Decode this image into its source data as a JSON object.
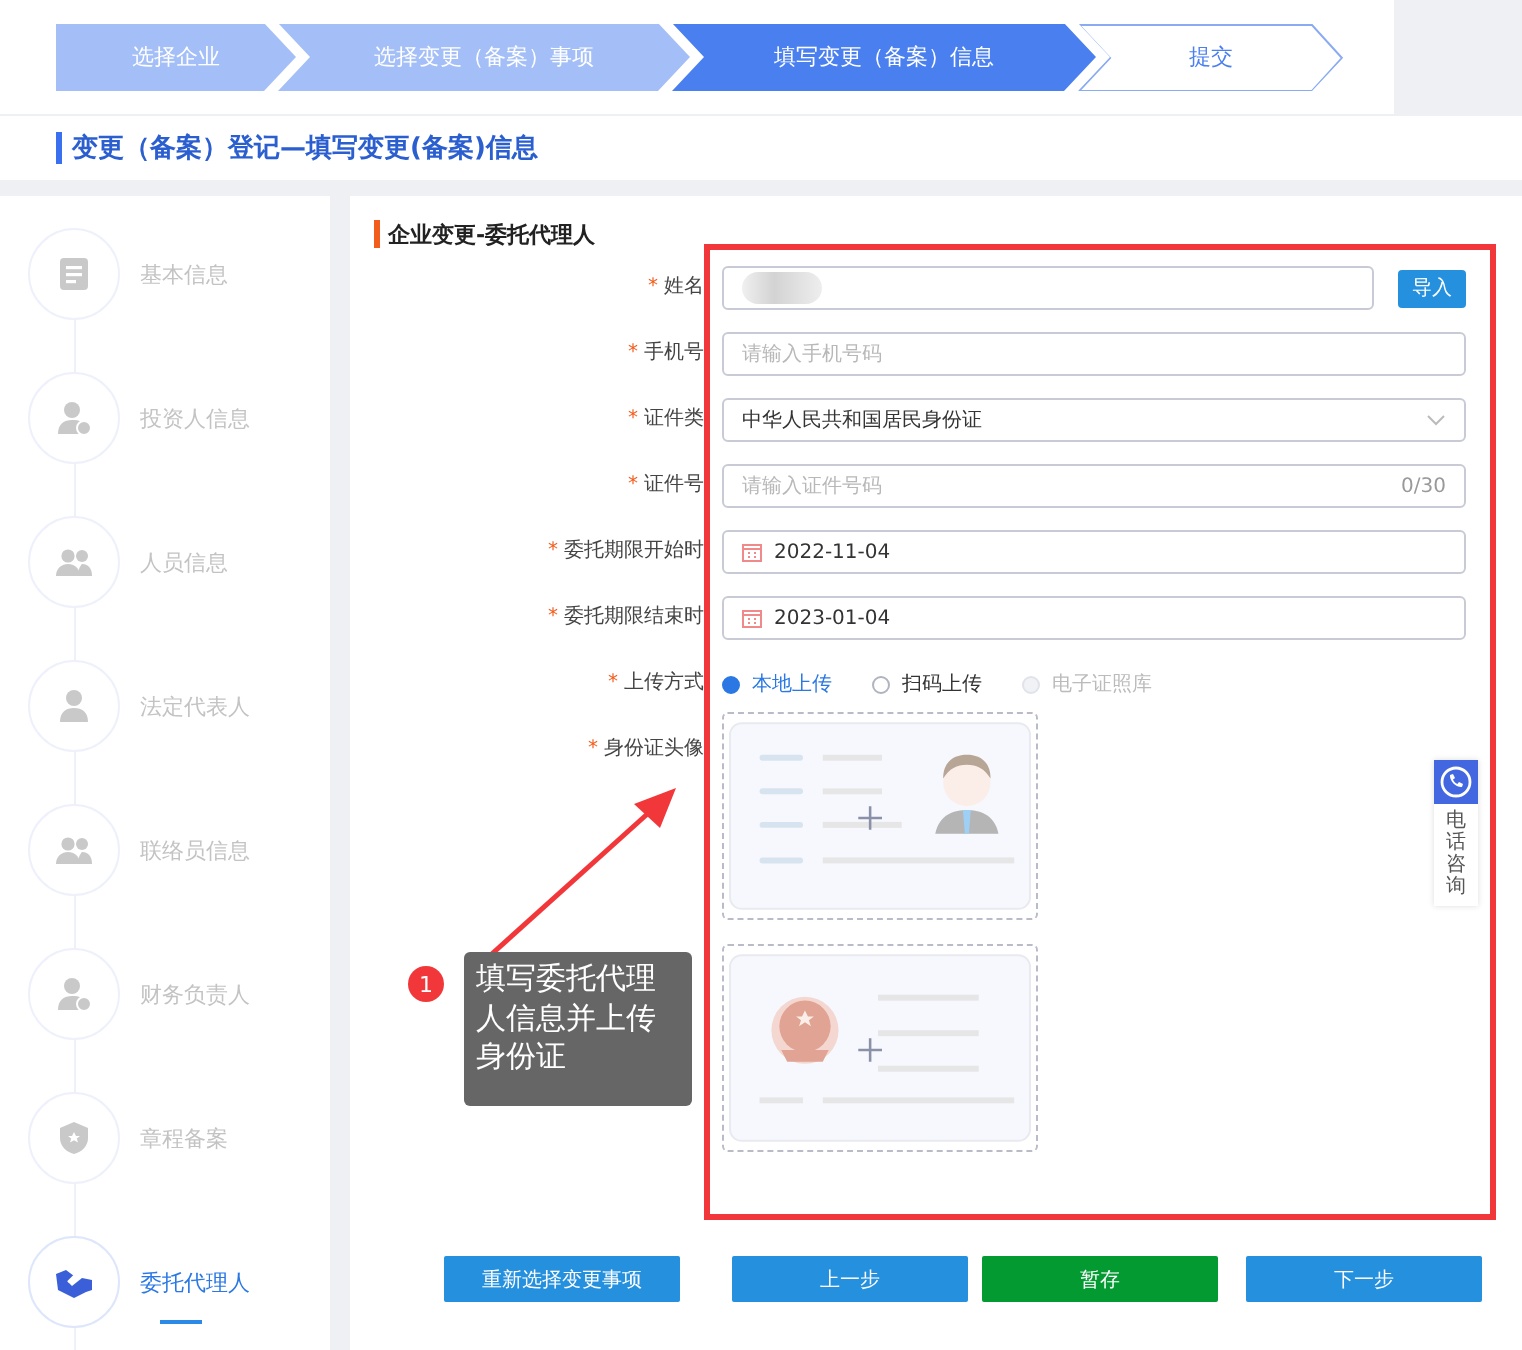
{
  "steps": [
    {
      "label": "选择企业",
      "done": true,
      "selected": false
    },
    {
      "label": "选择变更（备案）事项",
      "done": true,
      "selected": false
    },
    {
      "label": "填写变更（备案）信息",
      "selected": true
    },
    {
      "label": "提交",
      "done": false,
      "selected": false
    }
  ],
  "page_title": "变更（备案）登记—填写变更(备案)信息",
  "sidebar": {
    "items": [
      {
        "label": "基本信息",
        "selected": false
      },
      {
        "label": "投资人信息",
        "selected": false
      },
      {
        "label": "人员信息",
        "selected": false
      },
      {
        "label": "法定代表人",
        "selected": false
      },
      {
        "label": "联络员信息",
        "selected": false
      },
      {
        "label": "财务负责人",
        "selected": false
      },
      {
        "label": "章程备案",
        "selected": false
      },
      {
        "label": "委托代理人",
        "selected": true
      }
    ]
  },
  "section_title": "企业变更-委托代理人",
  "form": {
    "fields": [
      {
        "kind": "text",
        "label": "姓名",
        "required_mark": "*",
        "redacted": true,
        "button": "导入"
      },
      {
        "kind": "text",
        "label": "手机号",
        "required_mark": "*",
        "placeholder": "请输入手机号码"
      },
      {
        "kind": "select",
        "label": "证件类",
        "required_mark": "*",
        "value": "中华人民共和国居民身份证"
      },
      {
        "kind": "text",
        "label": "证件号",
        "required_mark": "*",
        "placeholder": "请输入证件号码",
        "counter": "0/30"
      },
      {
        "kind": "date",
        "label": "委托期限开始时",
        "required_mark": "*",
        "value": "2022-11-04"
      },
      {
        "kind": "date",
        "label": "委托期限结束时",
        "required_mark": "*",
        "value": "2023-01-04"
      },
      {
        "kind": "radio",
        "label": "上传方式",
        "required_mark": "*",
        "options": [
          {
            "label": "本地上传",
            "selected": true,
            "disabled": false
          },
          {
            "label": "扫码上传",
            "selected": false,
            "disabled": false
          },
          {
            "label": "电子证照库",
            "selected": false,
            "disabled": true
          }
        ]
      },
      {
        "kind": "upload",
        "label": "身份证头像",
        "required_mark": "*"
      },
      {
        "kind": "upload"
      }
    ]
  },
  "buttons": [
    {
      "label": "重新选择变更事项",
      "color": "#2590de"
    },
    {
      "label": "上一步",
      "color": "#2590de"
    },
    {
      "label": "暂存",
      "color": "#039a32"
    },
    {
      "label": "下一步",
      "color": "#2590de"
    }
  ],
  "phone_tab": {
    "label": "电话咨询"
  },
  "annotation": {
    "badge": "1",
    "text": "填写委托代理人信息并上传身份证"
  }
}
